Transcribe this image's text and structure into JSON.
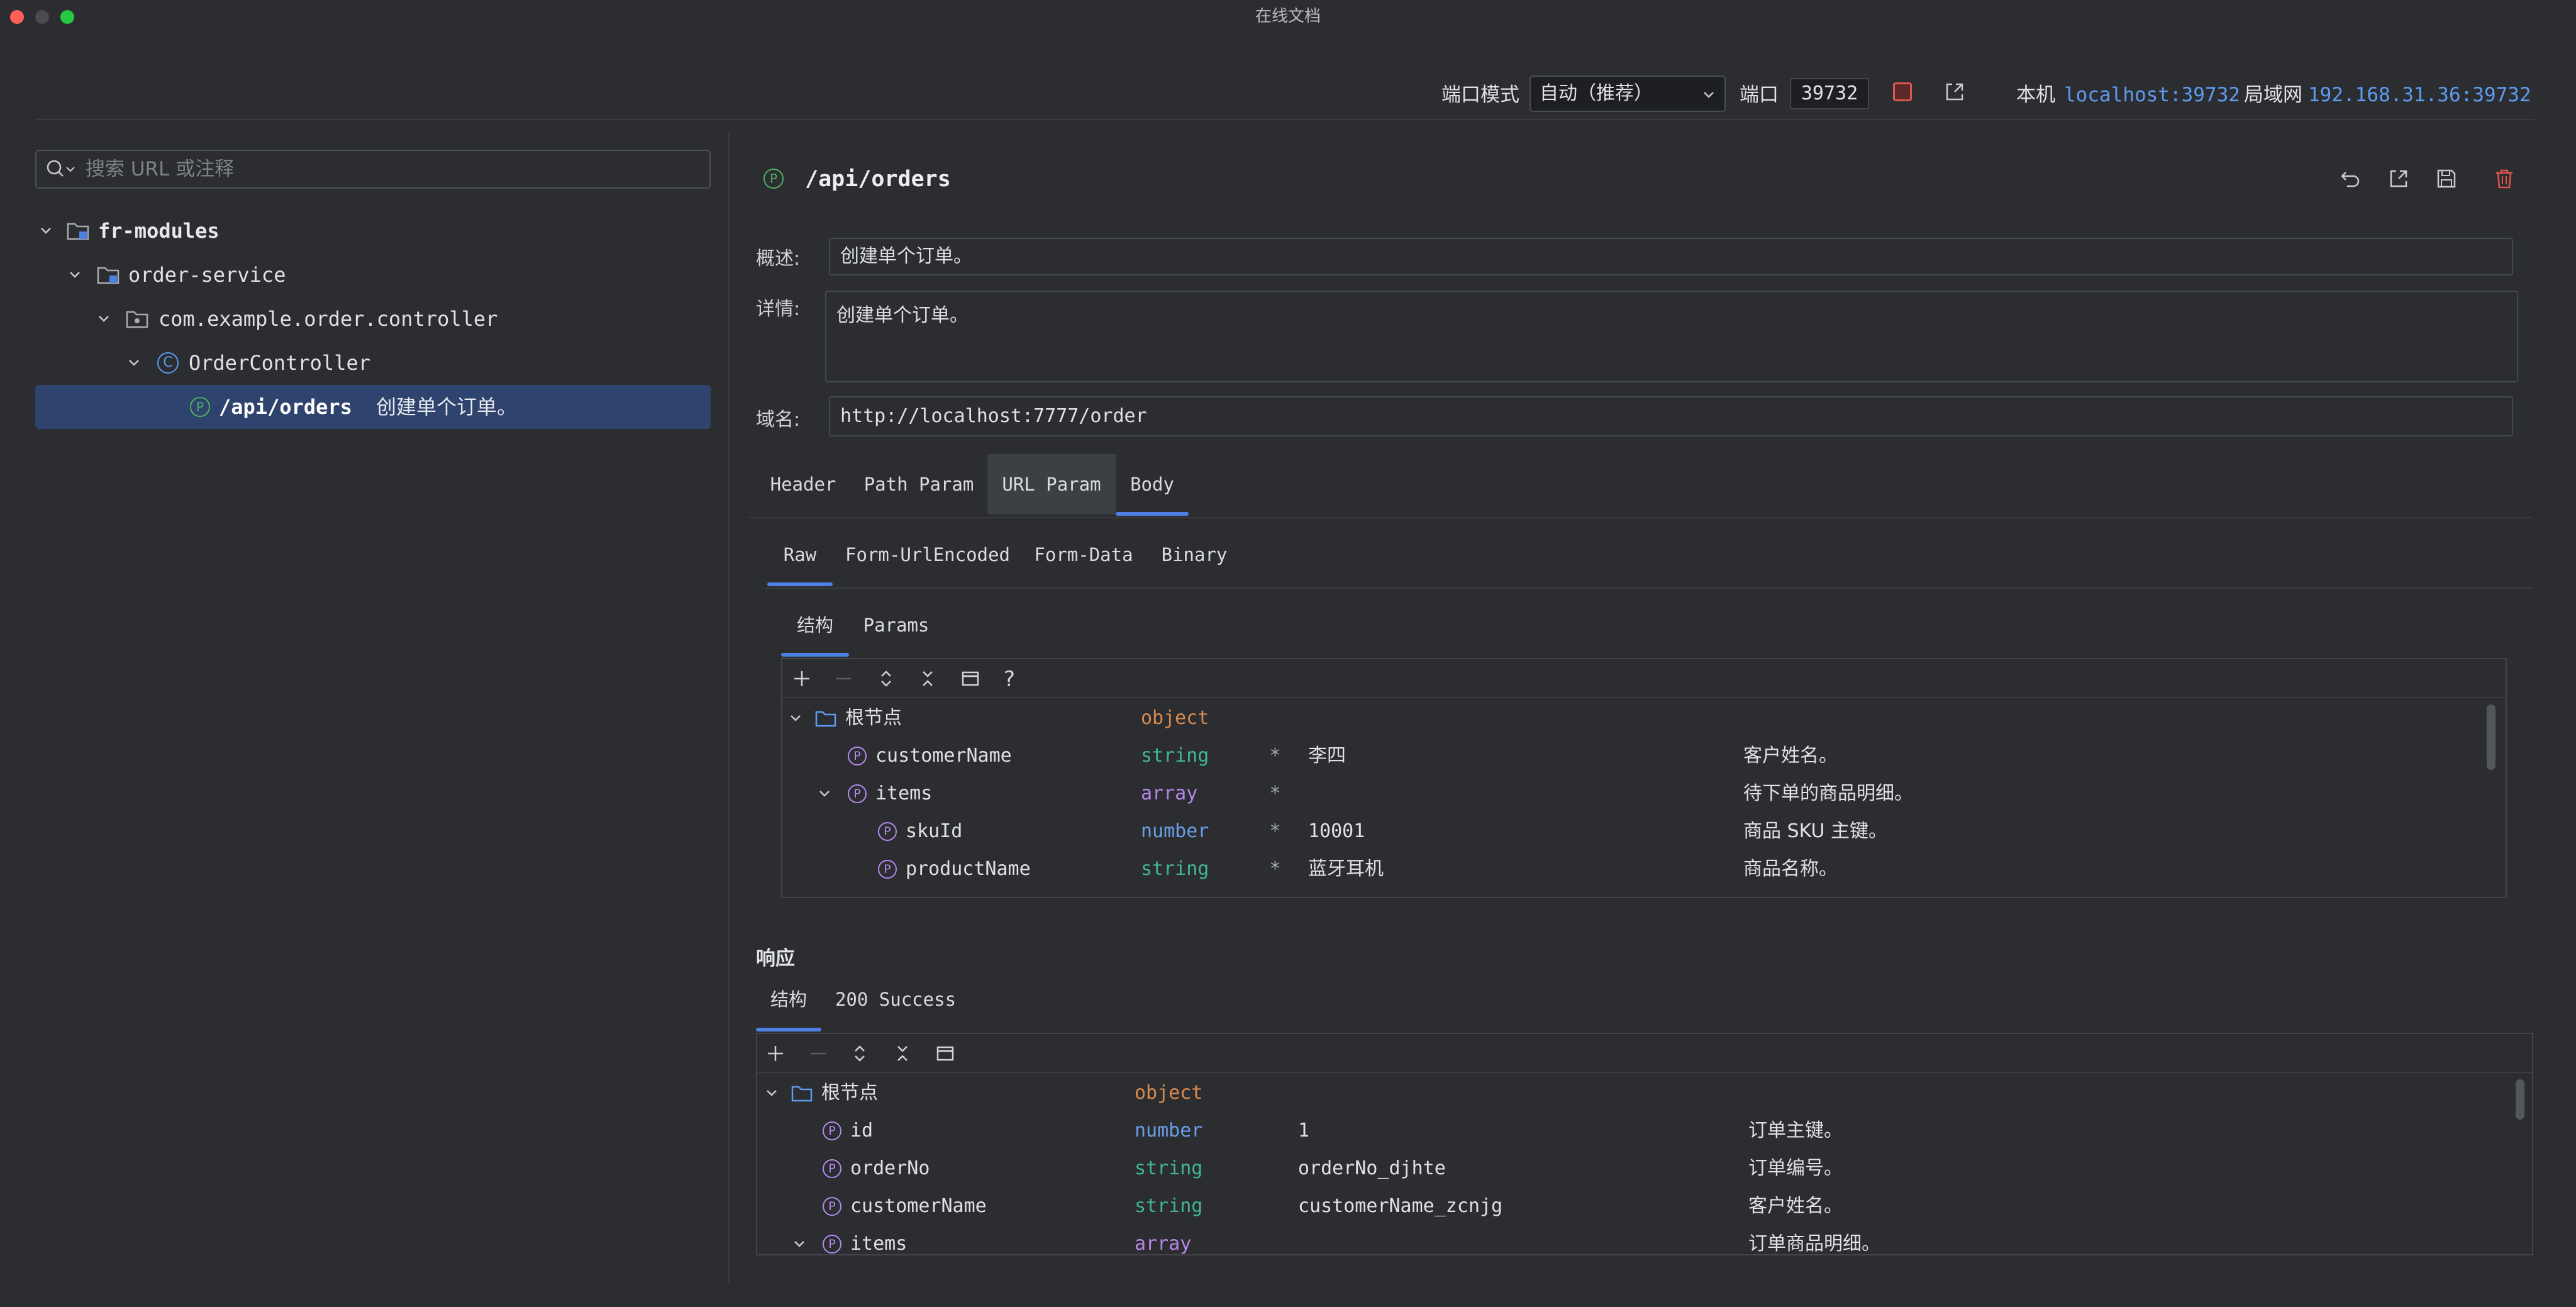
{
  "window": {
    "title": "在线文档"
  },
  "topbar": {
    "port_mode_label": "端口模式",
    "port_mode_value": "自动（推荐）",
    "port_label": "端口",
    "port_value": "39732",
    "local_label": "本机",
    "local_url": "localhost:39732",
    "lan_label": "局域网",
    "lan_url": "192.168.31.36:39732"
  },
  "sidebar": {
    "search_placeholder": "搜索 URL 或注释",
    "tree": [
      {
        "label": "fr-modules"
      },
      {
        "label": "order-service"
      },
      {
        "label": "com.example.order.controller"
      },
      {
        "label": "OrderController"
      },
      {
        "label": "/api/orders",
        "comment": "创建单个订单。"
      }
    ]
  },
  "endpoint": {
    "path": "/api/orders",
    "summary_label": "概述:",
    "summary_value": "创建单个订单。",
    "detail_label": "详情:",
    "detail_value": "创建单个订单。",
    "domain_label": "域名:",
    "domain_value": "http://localhost:7777/order"
  },
  "request_tabs": [
    "Header",
    "Path Param",
    "URL Param",
    "Body"
  ],
  "body_tabs": [
    "Raw",
    "Form-UrlEncoded",
    "Form-Data",
    "Binary"
  ],
  "structure_tabs": [
    "结构",
    "Params"
  ],
  "request_rows": [
    {
      "name": "根节点",
      "type": "object",
      "required": "",
      "value": "",
      "desc": ""
    },
    {
      "name": "customerName",
      "type": "string",
      "required": "*",
      "value": "李四",
      "desc": "客户姓名。"
    },
    {
      "name": "items",
      "type": "array",
      "required": "*",
      "value": "",
      "desc": "待下单的商品明细。"
    },
    {
      "name": "skuId",
      "type": "number",
      "required": "*",
      "value": "10001",
      "desc": "商品 SKU 主键。"
    },
    {
      "name": "productName",
      "type": "string",
      "required": "*",
      "value": "蓝牙耳机",
      "desc": "商品名称。"
    }
  ],
  "response": {
    "title": "响应",
    "tabs": [
      "结构",
      "200 Success"
    ],
    "rows": [
      {
        "name": "根节点",
        "type": "object",
        "value": "",
        "desc": ""
      },
      {
        "name": "id",
        "type": "number",
        "value": "1",
        "desc": "订单主键。"
      },
      {
        "name": "orderNo",
        "type": "string",
        "value": "orderNo_djhte",
        "desc": "订单编号。"
      },
      {
        "name": "customerName",
        "type": "string",
        "value": "customerName_zcnjg",
        "desc": "客户姓名。"
      },
      {
        "name": "items",
        "type": "array",
        "value": "",
        "desc": "订单商品明细。"
      }
    ]
  },
  "toolbar_help": "?",
  "colors": {
    "accent": "#4e7fe3",
    "selection": "#2e436e",
    "link": "#5e9bf0",
    "delete": "#e0554f"
  }
}
